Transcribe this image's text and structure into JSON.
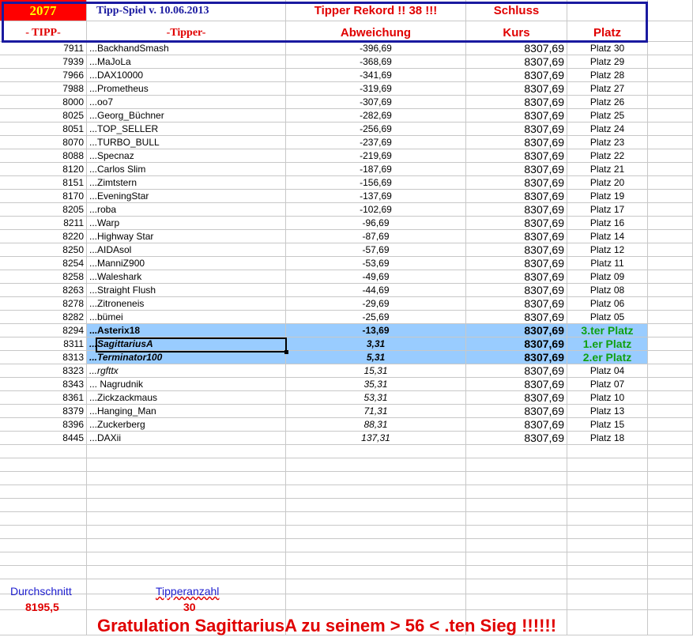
{
  "header": {
    "count": "2077",
    "title": "Tipp-Spiel v. 10.06.2013",
    "rekord": "Tipper Rekord !!  38  !!!",
    "schluss": "Schluss",
    "col_tipp": "- TIPP-",
    "col_tipper": "-Tipper-",
    "col_abw": "Abweichung",
    "col_kurs": "Kurs",
    "col_platz": "Platz"
  },
  "rows": [
    {
      "tipp": "7911",
      "name": "...BackhandSmash",
      "abw": "-396,69",
      "kurs": "8307,69",
      "platz": "Platz 30"
    },
    {
      "tipp": "7939",
      "name": "...MaJoLa",
      "abw": "-368,69",
      "kurs": "8307,69",
      "platz": "Platz 29"
    },
    {
      "tipp": "7966",
      "name": "...DAX10000",
      "abw": "-341,69",
      "kurs": "8307,69",
      "platz": "Platz 28"
    },
    {
      "tipp": "7988",
      "name": "...Prometheus",
      "abw": "-319,69",
      "kurs": "8307,69",
      "platz": "Platz 27"
    },
    {
      "tipp": "8000",
      "name": "...oo7",
      "abw": "-307,69",
      "kurs": "8307,69",
      "platz": "Platz 26"
    },
    {
      "tipp": "8025",
      "name": "...Georg_Büchner",
      "abw": "-282,69",
      "kurs": "8307,69",
      "platz": "Platz 25"
    },
    {
      "tipp": "8051",
      "name": "...TOP_SELLER",
      "abw": "-256,69",
      "kurs": "8307,69",
      "platz": "Platz 24"
    },
    {
      "tipp": "8070",
      "name": "...TURBO_BULL",
      "abw": "-237,69",
      "kurs": "8307,69",
      "platz": "Platz 23"
    },
    {
      "tipp": "8088",
      "name": "...Specnaz",
      "abw": "-219,69",
      "kurs": "8307,69",
      "platz": "Platz 22"
    },
    {
      "tipp": "8120",
      "name": "...Carlos Slim",
      "abw": "-187,69",
      "kurs": "8307,69",
      "platz": "Platz 21"
    },
    {
      "tipp": "8151",
      "name": "...Zimtstern",
      "abw": "-156,69",
      "kurs": "8307,69",
      "platz": "Platz 20"
    },
    {
      "tipp": "8170",
      "name": "...EveningStar",
      "abw": "-137,69",
      "kurs": "8307,69",
      "platz": "Platz 19"
    },
    {
      "tipp": "8205",
      "name": "...roba",
      "abw": "-102,69",
      "kurs": "8307,69",
      "platz": "Platz 17"
    },
    {
      "tipp": "8211",
      "name": "...Warp",
      "abw": "-96,69",
      "kurs": "8307,69",
      "platz": "Platz 16"
    },
    {
      "tipp": "8220",
      "name": "...Highway Star",
      "abw": "-87,69",
      "kurs": "8307,69",
      "platz": "Platz 14"
    },
    {
      "tipp": "8250",
      "name": "...AIDAsol",
      "abw": "-57,69",
      "kurs": "8307,69",
      "platz": "Platz 12"
    },
    {
      "tipp": "8254",
      "name": "...ManniZ900",
      "abw": "-53,69",
      "kurs": "8307,69",
      "platz": "Platz 11"
    },
    {
      "tipp": "8258",
      "name": "...Waleshark",
      "abw": "-49,69",
      "kurs": "8307,69",
      "platz": "Platz 09"
    },
    {
      "tipp": "8263",
      "name": "...Straight Flush",
      "abw": "-44,69",
      "kurs": "8307,69",
      "platz": "Platz 08"
    },
    {
      "tipp": "8278",
      "name": "...Zitroneneis",
      "abw": "-29,69",
      "kurs": "8307,69",
      "platz": "Platz 06"
    },
    {
      "tipp": "8282",
      "name": "...bümei",
      "abw": "-25,69",
      "kurs": "8307,69",
      "platz": "Platz 05"
    },
    {
      "tipp": "8294",
      "name": "...Asterix18",
      "abw": "-13,69",
      "kurs": "8307,69",
      "platz": "3.ter Platz",
      "hl": true
    },
    {
      "tipp": "8311",
      "name": "...SagittariusA",
      "abw": "3,31",
      "kurs": "8307,69",
      "platz": "1.er Platz",
      "hl": true,
      "it": true
    },
    {
      "tipp": "8313",
      "name": "...Terminator100",
      "abw": "5,31",
      "kurs": "8307,69",
      "platz": "2.er Platz",
      "hl": true,
      "it": true
    },
    {
      "tipp": "8323",
      "name": "...rgfttx",
      "abw": "15,31",
      "kurs": "8307,69",
      "platz": "Platz 04",
      "it": true
    },
    {
      "tipp": "8343",
      "name": "... Nagrudnik",
      "abw": "35,31",
      "kurs": "8307,69",
      "platz": "Platz 07",
      "pi": true
    },
    {
      "tipp": "8361",
      "name": "...Zickzackmaus",
      "abw": "53,31",
      "kurs": "8307,69",
      "platz": "Platz 10",
      "pi": true
    },
    {
      "tipp": "8379",
      "name": "...Hanging_Man",
      "abw": "71,31",
      "kurs": "8307,69",
      "platz": "Platz 13",
      "pi": true
    },
    {
      "tipp": "8396",
      "name": "...Zuckerberg",
      "abw": "88,31",
      "kurs": "8307,69",
      "platz": "Platz 15",
      "pi": true
    },
    {
      "tipp": "8445",
      "name": "...DAXii",
      "abw": "137,31",
      "kurs": "8307,69",
      "platz": "Platz 18",
      "pi": true
    }
  ],
  "summary": {
    "avg_label": "Durchschnitt",
    "avg_value": "8195,5",
    "count_label": "Tipperanzahl",
    "count_value": "30"
  },
  "congrats": "Gratulation SagittariusA  zu seinem > 56 < .ten Sieg !!!!!!"
}
